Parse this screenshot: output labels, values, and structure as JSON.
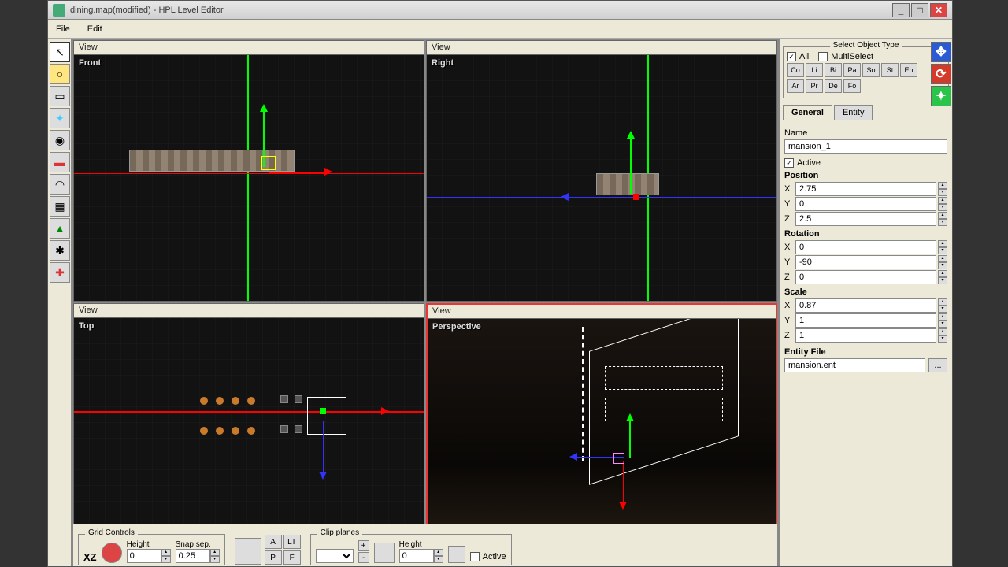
{
  "window": {
    "title": "dining.map(modified) - HPL Level Editor"
  },
  "menu": {
    "file": "File",
    "edit": "Edit"
  },
  "viewports": {
    "header": "View",
    "front": "Front",
    "right": "Right",
    "top": "Top",
    "perspective": "Perspective"
  },
  "objectType": {
    "title": "Select Object Type",
    "all": "All",
    "multi": "MultiSelect",
    "row1": [
      "Co",
      "Li",
      "Bi",
      "Pa",
      "So",
      "St",
      "En"
    ],
    "row2": [
      "Ar",
      "Pr",
      "De",
      "Fo"
    ]
  },
  "tabs": {
    "general": "General",
    "entity": "Entity"
  },
  "props": {
    "nameLabel": "Name",
    "name": "mansion_1",
    "activeLabel": "Active",
    "positionLabel": "Position",
    "rotationLabel": "Rotation",
    "scaleLabel": "Scale",
    "entityFileLabel": "Entity File",
    "entityFile": "mansion.ent",
    "browse": "...",
    "position": {
      "x": "2.75",
      "y": "0",
      "z": "2.5"
    },
    "rotation": {
      "x": "0",
      "y": "-90",
      "z": "0"
    },
    "scale": {
      "x": "0.87",
      "y": "1",
      "z": "1"
    },
    "axes": {
      "x": "X",
      "y": "Y",
      "z": "Z"
    }
  },
  "gridControls": {
    "title": "Grid Controls",
    "xz": "XZ",
    "heightLabel": "Height",
    "height": "0",
    "snapLabel": "Snap sep.",
    "snap": "0.25"
  },
  "clipPlanes": {
    "title": "Clip planes",
    "heightLabel": "Height",
    "height": "0",
    "activeLabel": "Active",
    "toggles": {
      "a": "A",
      "lt": "LT",
      "p": "P",
      "f": "F"
    }
  }
}
